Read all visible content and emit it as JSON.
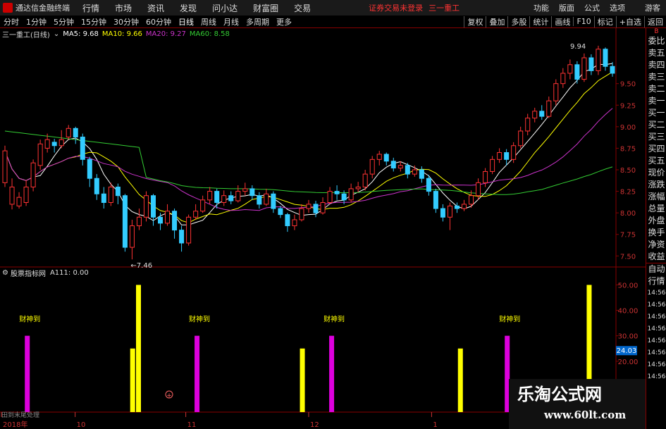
{
  "menubar": {
    "app_title": "通达信金融终端",
    "menus": [
      "行情",
      "市场",
      "资讯",
      "发现",
      "问小达",
      "财富圈",
      "交易"
    ],
    "login_warning": "证券交易未登录",
    "stock_name": "三一重工",
    "right": [
      "功能",
      "版面",
      "公式",
      "选项"
    ],
    "guest": "游客"
  },
  "tabs": {
    "items": [
      "分时",
      "1分钟",
      "5分钟",
      "15分钟",
      "30分钟",
      "60分钟",
      "日线",
      "周线",
      "月线",
      "多周期",
      "更多"
    ],
    "active": "日线",
    "right": [
      "复权",
      "叠加",
      "多股",
      "统计",
      "画线",
      "F10",
      "标记",
      "+自选",
      "返回"
    ]
  },
  "info": {
    "stock": "三一重工(日线)",
    "ma5": "MA5: 9.68",
    "ma10": "MA10: 9.66",
    "ma20": "MA20: 9.27",
    "ma60": "MA60: 8.58"
  },
  "sub": {
    "indicator": "股票指标网",
    "value": "A111: 0.00"
  },
  "sidebar": {
    "items": [
      "委比",
      "卖五",
      "卖四",
      "卖三",
      "卖二",
      "卖一",
      "买一",
      "买二",
      "买三",
      "买四",
      "买五",
      "现价",
      "涨跌",
      "涨幅",
      "总量",
      "外盘",
      "换手",
      "净资",
      "收益"
    ],
    "bottom_items": [
      "自动",
      "行情",
      "14:56",
      "14:56",
      "14:56",
      "14:56",
      "14:56",
      "14:56",
      "14:56",
      "14:56"
    ],
    "tiny": "B"
  },
  "annotations": {
    "high": "9.94",
    "low": "7.46",
    "cai": "财神到"
  },
  "bottom_label": "田到末尾处理",
  "watermark": {
    "line1": "乐淘公式网",
    "line2": "www.60lt.com"
  },
  "chart_data": [
    {
      "type": "candlestick",
      "title": "三一重工(日线)",
      "y_ticks": [
        9.5,
        9.25,
        9.0,
        8.75,
        8.5,
        8.25,
        8.0,
        7.75,
        7.5
      ],
      "ylim": [
        7.38,
        9.98
      ],
      "x_labels": [
        "2018年",
        "10",
        "11",
        "12",
        "1"
      ],
      "candles": [
        [
          8.35,
          8.72,
          8.78,
          8.3
        ],
        [
          8.1,
          8.3,
          8.4,
          8.04
        ],
        [
          8.08,
          8.18,
          8.24,
          8.05
        ],
        [
          8.12,
          8.3,
          8.38,
          8.08
        ],
        [
          8.3,
          8.58,
          8.62,
          8.25
        ],
        [
          8.55,
          8.8,
          8.85,
          8.5
        ],
        [
          8.75,
          8.85,
          8.92,
          8.7
        ],
        [
          8.82,
          8.78,
          8.86,
          8.7
        ],
        [
          8.78,
          8.85,
          8.96,
          8.75
        ],
        [
          8.88,
          8.98,
          9.02,
          8.85
        ],
        [
          8.98,
          8.88,
          9.0,
          8.8
        ],
        [
          8.88,
          8.62,
          8.92,
          8.55
        ],
        [
          8.62,
          8.4,
          8.65,
          8.3
        ],
        [
          8.4,
          8.22,
          8.45,
          8.15
        ],
        [
          8.22,
          8.12,
          8.3,
          8.05
        ],
        [
          8.12,
          8.3,
          8.35,
          8.08
        ],
        [
          8.3,
          8.2,
          8.34,
          8.1
        ],
        [
          8.2,
          7.6,
          8.22,
          7.55
        ],
        [
          7.6,
          7.85,
          7.92,
          7.46
        ],
        [
          7.85,
          7.95,
          8.05,
          7.8
        ],
        [
          7.95,
          8.2,
          8.25,
          7.9
        ],
        [
          8.2,
          7.95,
          8.22,
          7.85
        ],
        [
          7.95,
          7.88,
          8.0,
          7.8
        ],
        [
          7.88,
          8.02,
          8.1,
          7.85
        ],
        [
          8.02,
          7.8,
          8.05,
          7.7
        ],
        [
          7.8,
          7.65,
          7.85,
          7.55
        ],
        [
          7.65,
          7.95,
          7.98,
          7.62
        ],
        [
          7.95,
          8.02,
          8.1,
          7.92
        ],
        [
          8.02,
          8.15,
          8.2,
          8.0
        ],
        [
          8.15,
          8.25,
          8.3,
          8.1
        ],
        [
          8.25,
          8.12,
          8.28,
          8.05
        ],
        [
          8.12,
          8.2,
          8.26,
          8.08
        ],
        [
          8.2,
          8.14,
          8.25,
          8.1
        ],
        [
          8.14,
          8.25,
          8.32,
          8.12
        ],
        [
          8.25,
          8.28,
          8.35,
          8.2
        ],
        [
          8.28,
          8.2,
          8.32,
          8.15
        ],
        [
          8.2,
          8.1,
          8.24,
          8.05
        ],
        [
          8.1,
          8.22,
          8.28,
          8.08
        ],
        [
          8.22,
          8.05,
          8.25,
          8.0
        ],
        [
          8.05,
          7.98,
          8.08,
          7.94
        ],
        [
          7.98,
          7.85,
          8.0,
          7.78
        ],
        [
          7.85,
          7.92,
          7.98,
          7.8
        ],
        [
          7.92,
          8.05,
          8.1,
          7.9
        ],
        [
          8.05,
          8.1,
          8.15,
          8.0
        ],
        [
          8.1,
          8.0,
          8.14,
          7.95
        ],
        [
          8.0,
          8.12,
          8.18,
          7.98
        ],
        [
          8.12,
          8.25,
          8.3,
          8.1
        ],
        [
          8.25,
          8.22,
          8.32,
          8.15
        ],
        [
          8.22,
          8.15,
          8.26,
          8.1
        ],
        [
          8.15,
          8.28,
          8.34,
          8.12
        ],
        [
          8.28,
          8.3,
          8.36,
          8.24
        ],
        [
          8.3,
          8.45,
          8.5,
          8.26
        ],
        [
          8.45,
          8.62,
          8.66,
          8.4
        ],
        [
          8.62,
          8.68,
          8.72,
          8.55
        ],
        [
          8.68,
          8.6,
          8.7,
          8.55
        ],
        [
          8.6,
          8.52,
          8.64,
          8.48
        ],
        [
          8.52,
          8.55,
          8.6,
          8.48
        ],
        [
          8.55,
          8.45,
          8.58,
          8.4
        ],
        [
          8.45,
          8.5,
          8.55,
          8.42
        ],
        [
          8.5,
          8.4,
          8.54,
          8.35
        ],
        [
          8.4,
          8.25,
          8.44,
          8.2
        ],
        [
          8.25,
          8.05,
          8.28,
          8.0
        ],
        [
          8.05,
          7.95,
          8.1,
          7.9
        ],
        [
          7.95,
          8.08,
          8.12,
          7.8
        ],
        [
          8.08,
          8.05,
          8.12,
          8.0
        ],
        [
          8.05,
          8.1,
          8.15,
          8.02
        ],
        [
          8.1,
          8.2,
          8.26,
          8.06
        ],
        [
          8.2,
          8.35,
          8.4,
          8.15
        ],
        [
          8.35,
          8.48,
          8.52,
          8.3
        ],
        [
          8.48,
          8.62,
          8.66,
          8.45
        ],
        [
          8.62,
          8.7,
          8.75,
          8.58
        ],
        [
          8.7,
          8.62,
          8.74,
          8.55
        ],
        [
          8.62,
          8.78,
          8.82,
          8.58
        ],
        [
          8.78,
          8.95,
          9.0,
          8.75
        ],
        [
          8.95,
          9.1,
          9.15,
          8.9
        ],
        [
          9.1,
          9.18,
          9.22,
          9.05
        ],
        [
          9.18,
          9.12,
          9.25,
          9.08
        ],
        [
          9.12,
          9.3,
          9.35,
          9.1
        ],
        [
          9.3,
          9.5,
          9.55,
          9.25
        ],
        [
          9.5,
          9.62,
          9.68,
          9.45
        ],
        [
          9.62,
          9.72,
          9.78,
          9.55
        ],
        [
          9.72,
          9.55,
          9.76,
          9.5
        ],
        [
          9.55,
          9.8,
          9.85,
          9.52
        ],
        [
          9.8,
          9.65,
          9.84,
          9.6
        ],
        [
          9.65,
          9.9,
          9.94,
          9.6
        ],
        [
          9.9,
          9.7,
          9.92,
          9.65
        ],
        [
          9.7,
          9.62,
          9.75,
          9.58
        ]
      ],
      "ma_lines": [
        {
          "name": "MA5",
          "color": "#ffffff"
        },
        {
          "name": "MA10",
          "color": "#ffff00"
        },
        {
          "name": "MA20",
          "color": "#cc33cc"
        },
        {
          "name": "MA60",
          "color": "#33cc33"
        }
      ]
    },
    {
      "type": "bar",
      "title": "A111",
      "y_ticks": [
        50,
        40,
        30,
        20
      ],
      "ylim": [
        0,
        54
      ],
      "bars": [
        {
          "i": 4,
          "v": 30,
          "c": "magenta"
        },
        {
          "i": 22,
          "v": 25,
          "c": "yellow"
        },
        {
          "i": 23,
          "v": 50,
          "c": "yellow"
        },
        {
          "i": 33,
          "v": 30,
          "c": "magenta"
        },
        {
          "i": 51,
          "v": 25,
          "c": "yellow"
        },
        {
          "i": 56,
          "v": 30,
          "c": "magenta"
        },
        {
          "i": 78,
          "v": 25,
          "c": "yellow"
        },
        {
          "i": 86,
          "v": 30,
          "c": "magenta"
        },
        {
          "i": 100,
          "v": 50,
          "c": "yellow"
        }
      ],
      "current_value": "24.03"
    }
  ]
}
